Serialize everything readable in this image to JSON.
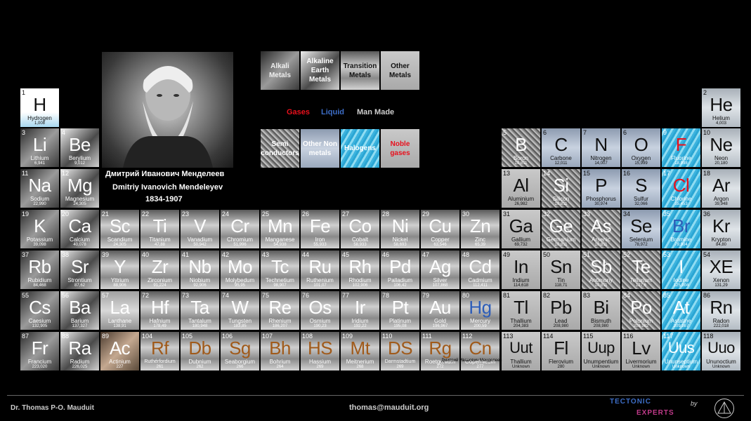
{
  "portrait": {
    "name_ru": "Дмитрий Иванович Менделеев",
    "name_en": "Dmitriy Ivanovich Mendeleyev",
    "years": "1834-1907"
  },
  "legend": {
    "alkali": "Alkali Metals",
    "alkaline": "Alkaline Earth Metals",
    "transition": "Transition Metals",
    "other_metals": "Other Metals",
    "semi": "Semi conductors",
    "other_nonmetals": "Other Non metals",
    "halogens": "Halogens",
    "noble": "Noble gases",
    "gases": "Gases",
    "liquid": "Liquid",
    "man_made": "Man Made",
    "colors": {
      "gases": "#e8101c",
      "liquid": "#2d5db8",
      "man_made": "#cfcfcf"
    }
  },
  "elements": [
    {
      "n": "1",
      "s": "H",
      "name": "Hydrogen",
      "m": "1,008",
      "state": "gas",
      "type": "hydrogen"
    },
    {
      "n": "2",
      "s": "He",
      "name": "Helium",
      "m": "4,003",
      "state": "gas",
      "type": "noble"
    },
    {
      "n": "3",
      "s": "Li",
      "name": "Lithium",
      "m": "6,941",
      "state": "solid",
      "type": "alkali"
    },
    {
      "n": "4",
      "s": "Be",
      "name": "Berylium",
      "m": "9,012",
      "state": "solid",
      "type": "earth"
    },
    {
      "n": "5",
      "s": "B",
      "name": "Boron",
      "m": "10,811",
      "state": "solid",
      "type": "semi"
    },
    {
      "n": "6",
      "s": "C",
      "name": "Carbone",
      "m": "12,011",
      "state": "solid",
      "type": "nonmetal"
    },
    {
      "n": "7",
      "s": "N",
      "name": "Nitrogen",
      "m": "14,007",
      "state": "gas",
      "type": "nonmetal"
    },
    {
      "n": "6",
      "s": "O",
      "name": "Oxygen",
      "m": "15,999",
      "state": "gas",
      "type": "nonmetal"
    },
    {
      "n": "9",
      "s": "F",
      "name": "Fluorine",
      "m": "18,998",
      "state": "gas",
      "type": "halogen"
    },
    {
      "n": "10",
      "s": "Ne",
      "name": "Neon",
      "m": "20,180",
      "state": "gas",
      "type": "noble"
    },
    {
      "n": "11",
      "s": "Na",
      "name": "Sodium",
      "m": "22,990",
      "state": "solid",
      "type": "alkali"
    },
    {
      "n": "12",
      "s": "Mg",
      "name": "Magnesium",
      "m": "24,305",
      "state": "solid",
      "type": "earth"
    },
    {
      "n": "13",
      "s": "Al",
      "name": "Aluminium",
      "m": "26,982",
      "state": "solid",
      "type": "other"
    },
    {
      "n": "14",
      "s": "Si",
      "name": "Silicon",
      "m": "10,811",
      "state": "solid",
      "type": "semi"
    },
    {
      "n": "15",
      "s": "P",
      "name": "Phosphorus",
      "m": "30,974",
      "state": "solid",
      "type": "nonmetal"
    },
    {
      "n": "16",
      "s": "S",
      "name": "Sulfur",
      "m": "32,066",
      "state": "solid",
      "type": "nonmetal"
    },
    {
      "n": "17",
      "s": "Cl",
      "name": "Chlorine",
      "m": "35,453",
      "state": "gas",
      "type": "halogen"
    },
    {
      "n": "18",
      "s": "Ar",
      "name": "Argon",
      "m": "39,948",
      "state": "gas",
      "type": "noble"
    },
    {
      "n": "19",
      "s": "K",
      "name": "Potassium",
      "m": "39,098",
      "state": "solid",
      "type": "alkali"
    },
    {
      "n": "20",
      "s": "Ca",
      "name": "Calcium",
      "m": "40,078",
      "state": "solid",
      "type": "earth"
    },
    {
      "n": "21",
      "s": "Sc",
      "name": "Scandium",
      "m": "24,305",
      "state": "solid",
      "type": "metal"
    },
    {
      "n": "22",
      "s": "Ti",
      "name": "Titanium",
      "m": "47,88",
      "state": "solid",
      "type": "metal"
    },
    {
      "n": "23",
      "s": "V",
      "name": "Vanadium",
      "m": "50,942",
      "state": "solid",
      "type": "metal"
    },
    {
      "n": "24",
      "s": "Cr",
      "name": "Chromium",
      "m": "51,996",
      "state": "solid",
      "type": "metal"
    },
    {
      "n": "25",
      "s": "Mn",
      "name": "Manganese",
      "m": "54,938",
      "state": "solid",
      "type": "metal"
    },
    {
      "n": "26",
      "s": "Fe",
      "name": "Iron",
      "m": "55,933",
      "state": "solid",
      "type": "metal"
    },
    {
      "n": "27",
      "s": "Co",
      "name": "Cobalt",
      "m": "58,933",
      "state": "solid",
      "type": "metal"
    },
    {
      "n": "28",
      "s": "Ni",
      "name": "Nickel",
      "m": "58,693",
      "state": "solid",
      "type": "metal"
    },
    {
      "n": "29",
      "s": "Cu",
      "name": "Copper",
      "m": "63,546",
      "state": "solid",
      "type": "metal"
    },
    {
      "n": "30",
      "s": "Zn",
      "name": "Zinc",
      "m": "65,39",
      "state": "solid",
      "type": "metal"
    },
    {
      "n": "31",
      "s": "Ga",
      "name": "Gallium",
      "m": "69,732",
      "state": "solid",
      "type": "other"
    },
    {
      "n": "32",
      "s": "Ge",
      "name": "Germanium",
      "m": "10,811",
      "state": "solid",
      "type": "semi"
    },
    {
      "n": "33",
      "s": "As",
      "name": "Arsenic",
      "m": "10,811",
      "state": "solid",
      "type": "semi"
    },
    {
      "n": "34",
      "s": "Se",
      "name": "Selenium",
      "m": "78,972",
      "state": "solid",
      "type": "nonmetal"
    },
    {
      "n": "35",
      "s": "Br",
      "name": "Bromine",
      "m": "79,904",
      "state": "liquid",
      "type": "halogen"
    },
    {
      "n": "36",
      "s": "Kr",
      "name": "Krypton",
      "m": "84,80",
      "state": "gas",
      "type": "noble"
    },
    {
      "n": "37",
      "s": "Rb",
      "name": "Rubidium",
      "m": "84,468",
      "state": "solid",
      "type": "alkali"
    },
    {
      "n": "38",
      "s": "Sr",
      "name": "Strontium",
      "m": "87,62",
      "state": "solid",
      "type": "earth"
    },
    {
      "n": "39",
      "s": "Y",
      "name": "Yttrium",
      "m": "88,906",
      "state": "solid",
      "type": "metal"
    },
    {
      "n": "40",
      "s": "Zr",
      "name": "Zirconium",
      "m": "91,224",
      "state": "solid",
      "type": "metal"
    },
    {
      "n": "41",
      "s": "Nb",
      "name": "Niobium",
      "m": "92,906",
      "state": "solid",
      "type": "metal"
    },
    {
      "n": "42",
      "s": "Mo",
      "name": "Molybedum",
      "m": "95,95",
      "state": "solid",
      "type": "metal"
    },
    {
      "n": "43",
      "s": "Tc",
      "name": "Technetium",
      "m": "98,907",
      "state": "solid",
      "type": "metal"
    },
    {
      "n": "44",
      "s": "Ru",
      "name": "Ruthenium",
      "m": "101,07",
      "state": "solid",
      "type": "metal"
    },
    {
      "n": "45",
      "s": "Rh",
      "name": "Rhodium",
      "m": "102,906",
      "state": "solid",
      "type": "metal"
    },
    {
      "n": "46",
      "s": "Pd",
      "name": "Palladium",
      "m": "106,42",
      "state": "solid",
      "type": "metal"
    },
    {
      "n": "47",
      "s": "Ag",
      "name": "Silver",
      "m": "107,868",
      "state": "solid",
      "type": "metal"
    },
    {
      "n": "48",
      "s": "Cd",
      "name": "Cadmium",
      "m": "112,411",
      "state": "solid",
      "type": "metal"
    },
    {
      "n": "49",
      "s": "In",
      "name": "Indium",
      "m": "114,618",
      "state": "solid",
      "type": "other"
    },
    {
      "n": "50",
      "s": "Sn",
      "name": "Tin",
      "m": "118,71",
      "state": "solid",
      "type": "other"
    },
    {
      "n": "51",
      "s": "Sb",
      "name": "Antimony",
      "m": "10,811",
      "state": "solid",
      "type": "semi"
    },
    {
      "n": "52",
      "s": "Te",
      "name": "Tellurium",
      "m": "127,6",
      "state": "solid",
      "type": "semi"
    },
    {
      "n": "53",
      "s": "I",
      "name": "Iodine",
      "m": "125,904",
      "state": "solid",
      "type": "halogen"
    },
    {
      "n": "54",
      "s": "XE",
      "name": "Xenon",
      "m": "131,29",
      "state": "gas",
      "type": "noble"
    },
    {
      "n": "55",
      "s": "Cs",
      "name": "Caesium",
      "m": "132,905",
      "state": "solid",
      "type": "alkali"
    },
    {
      "n": "56",
      "s": "Ba",
      "name": "Barium",
      "m": "137,327",
      "state": "solid",
      "type": "earth"
    },
    {
      "n": "57",
      "s": "La",
      "name": "Lanthane",
      "m": "138,91",
      "state": "solid",
      "type": "lanth"
    },
    {
      "n": "72",
      "s": "Hf",
      "name": "Hafnium",
      "m": "178,49",
      "state": "solid",
      "type": "metal"
    },
    {
      "n": "73",
      "s": "Ta",
      "name": "Tantalum",
      "m": "180,948",
      "state": "solid",
      "type": "metal"
    },
    {
      "n": "74",
      "s": "W",
      "name": "Tungsten",
      "m": "183,85",
      "state": "solid",
      "type": "metal"
    },
    {
      "n": "75",
      "s": "Re",
      "name": "Rhenium",
      "m": "186,207",
      "state": "solid",
      "type": "metal"
    },
    {
      "n": "76",
      "s": "Os",
      "name": "Osmium",
      "m": "190,23",
      "state": "solid",
      "type": "metal"
    },
    {
      "n": "77",
      "s": "Ir",
      "name": "Iridium",
      "m": "192,22",
      "state": "solid",
      "type": "metal"
    },
    {
      "n": "78",
      "s": "Pt",
      "name": "Platinum",
      "m": "195,08",
      "state": "solid",
      "type": "metal"
    },
    {
      "n": "79",
      "s": "Au",
      "name": "Gold",
      "m": "196,967",
      "state": "solid",
      "type": "metal"
    },
    {
      "n": "80",
      "s": "Hg",
      "name": "Mercury",
      "m": "200,59",
      "state": "liquid",
      "type": "metal"
    },
    {
      "n": "81",
      "s": "Tl",
      "name": "Thallium",
      "m": "204,383",
      "state": "solid",
      "type": "other"
    },
    {
      "n": "82",
      "s": "Pb",
      "name": "Lead",
      "m": "208,980",
      "state": "solid",
      "type": "other"
    },
    {
      "n": "83",
      "s": "Bi",
      "name": "Bismuth",
      "m": "208,980",
      "state": "solid",
      "type": "other"
    },
    {
      "n": "84",
      "s": "Po",
      "name": "Polonium",
      "m": "208,982",
      "state": "solid",
      "type": "semi"
    },
    {
      "n": "85",
      "s": "At",
      "name": "Astatine",
      "m": "209,987",
      "state": "solid",
      "type": "halogen"
    },
    {
      "n": "86",
      "s": "Rn",
      "name": "Radon",
      "m": "222,018",
      "state": "gas",
      "type": "noble"
    },
    {
      "n": "87",
      "s": "Fr",
      "name": "Francium",
      "m": "223,020",
      "state": "solid",
      "type": "alkali"
    },
    {
      "n": "88",
      "s": "Ra",
      "name": "Radium",
      "m": "226,025",
      "state": "solid",
      "type": "earth"
    },
    {
      "n": "89",
      "s": "Ac",
      "name": "Actinium",
      "m": "227",
      "state": "solid",
      "type": "actin"
    },
    {
      "n": "104",
      "s": "Rf",
      "name": "Ruthérfordium",
      "m": "261",
      "state": "man_made",
      "type": "metal"
    },
    {
      "n": "105",
      "s": "Db",
      "name": "Dubnium",
      "m": "262",
      "state": "man_made",
      "type": "metal"
    },
    {
      "n": "106",
      "s": "Sg",
      "name": "Seaborgium",
      "m": "266",
      "state": "man_made",
      "type": "metal"
    },
    {
      "n": "107",
      "s": "Bh",
      "name": "Bohrium",
      "m": "264",
      "state": "man_made",
      "type": "metal"
    },
    {
      "n": "108",
      "s": "HS",
      "name": "Hassium",
      "m": "269",
      "state": "man_made",
      "type": "metal"
    },
    {
      "n": "109",
      "s": "Mt",
      "name": "Meitnerium",
      "m": "268",
      "state": "man_made",
      "type": "metal"
    },
    {
      "n": "110",
      "s": "DS",
      "name": "Darmstadtium",
      "m": "269",
      "state": "man_made",
      "type": "metal"
    },
    {
      "n": "111",
      "s": "Rg",
      "name": "Roetgenium",
      "m": "272",
      "state": "man_made",
      "type": "metal"
    },
    {
      "n": "112",
      "s": "Cn",
      "name": "Copernicum",
      "m": "277",
      "state": "man_made",
      "type": "metal"
    },
    {
      "n": "113",
      "s": "Uut",
      "name": "Thallium",
      "m": "Unknown",
      "state": "solid",
      "type": "other"
    },
    {
      "n": "114",
      "s": "Fl",
      "name": "Flerovium",
      "m": "280",
      "state": "solid",
      "type": "other"
    },
    {
      "n": "115",
      "s": "Uup",
      "name": "Unumpentium",
      "m": "Unknown",
      "state": "solid",
      "type": "other"
    },
    {
      "n": "116",
      "s": "Lv",
      "name": "Livermorium",
      "m": "Unknown",
      "state": "solid",
      "type": "other"
    },
    {
      "n": "117",
      "s": "Uus",
      "name": "Ununseptium",
      "m": "Unknown",
      "state": "solid",
      "type": "halogen"
    },
    {
      "n": "118",
      "s": "Uuo",
      "name": "Ununoctium",
      "m": "Unknown",
      "state": "solid",
      "type": "noble"
    }
  ],
  "overlay_text": "Дмитрий Иванович Менделеев",
  "footer": {
    "author": "Dr. Thomas P-O. Mauduit",
    "email": "thomas@mauduit.org",
    "logo_line1": "TECTONIC",
    "logo_line2": "EXPERTS",
    "by": "by"
  }
}
